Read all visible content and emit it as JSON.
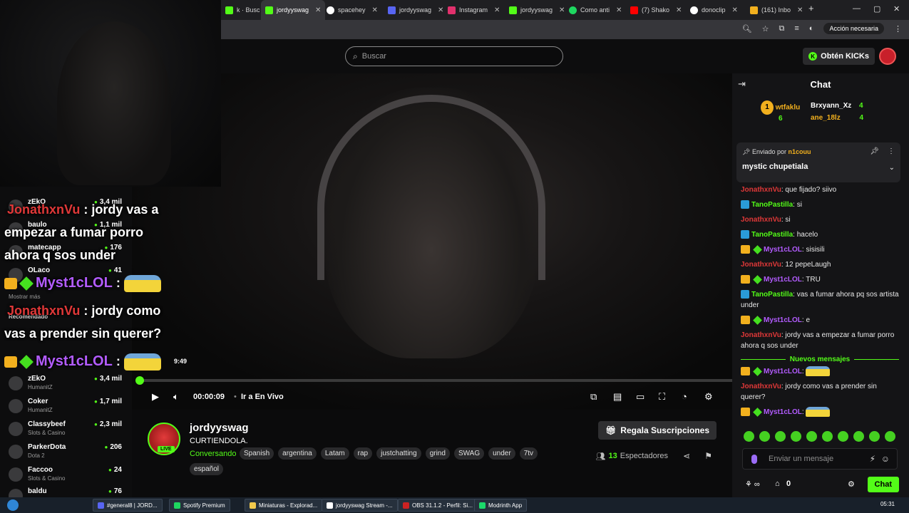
{
  "browser": {
    "tabs": [
      {
        "label": "k · Busc",
        "color": "#53fc18"
      },
      {
        "label": "jordyyswag",
        "color": "#53fc18",
        "active": true
      },
      {
        "label": "spacehey",
        "color": "#ffffff"
      },
      {
        "label": "jordyyswag",
        "color": "#5865f2"
      },
      {
        "label": "Instagram",
        "color": "#e1306c"
      },
      {
        "label": "jordyyswag",
        "color": "#53fc18"
      },
      {
        "label": "Como anti",
        "color": "#1ed760"
      },
      {
        "label": "(7) Shako",
        "color": "#ff0000"
      },
      {
        "label": "donoclip",
        "color": "#ffffff"
      },
      {
        "label": "(161) Inbo",
        "color": "#f2b01e"
      }
    ],
    "new_tab": "+",
    "request_button": "Acción necesaria"
  },
  "site": {
    "search_placeholder": "Buscar",
    "kicks_button": "Obtén KICKs",
    "kicks_icon": "K"
  },
  "overlay": {
    "lines": [
      {
        "user": "JonathxnVu",
        "text": " : jordy vas a"
      },
      {
        "text": "empezar a fumar porro"
      },
      {
        "text": "ahora q sos under"
      },
      {
        "user": "Myst1cLOL",
        "text": " :"
      },
      {
        "user": "JonathxnVu",
        "text": " : jordy como"
      },
      {
        "text": "vas a prender sin querer?"
      },
      {
        "user": "Myst1cLOL",
        "text": " :"
      }
    ],
    "timecode": "9:49"
  },
  "sidebar": {
    "recommended_label": "Recomendado",
    "show_more": "Mostrar más",
    "items_top": [
      {
        "name": "zEkO",
        "category": "",
        "count": "3,4 mil"
      },
      {
        "name": "baulo",
        "category": "",
        "count": "1,1 mil"
      },
      {
        "name": "matecapp",
        "category": "",
        "count": "176"
      },
      {
        "name": "OLaco",
        "category": "",
        "count": "41"
      }
    ],
    "items": [
      {
        "name": "zEkO",
        "category": "HumanitZ",
        "count": "3,4 mil"
      },
      {
        "name": "Coker",
        "category": "HumanitZ",
        "count": "1,7 mil"
      },
      {
        "name": "Classybeef",
        "category": "Slots & Casino",
        "count": "2,3 mil"
      },
      {
        "name": "ParkerDota",
        "category": "Dota 2",
        "count": "206"
      },
      {
        "name": "Faccoo",
        "category": "Slots & Casino",
        "count": "24"
      },
      {
        "name": "baldu",
        "category": "",
        "count": "76"
      }
    ]
  },
  "player": {
    "progress": 0.0,
    "time": "00:00:09",
    "live_link": "Ir a En Vivo"
  },
  "stream": {
    "channel": "jordyyswag",
    "title": "CURTIENDOLA.",
    "category": "Conversando",
    "live_badge": "LIVE",
    "tags": [
      "Spanish",
      "argentina",
      "Latam",
      "rap",
      "justchatting",
      "grind",
      "SWAG",
      "under",
      "7tv"
    ],
    "tag_extra": "español",
    "subs_button": "Regala Suscripciones",
    "viewers_count": "13",
    "viewers_label": "Espectadores"
  },
  "chat": {
    "title": "Chat",
    "leaderboard": [
      {
        "rank": "1",
        "name": "wtfaklu",
        "score": "6"
      },
      {
        "name": "Brxyann_Xz",
        "score": "4"
      },
      {
        "name": "ane_18lz",
        "score": "4"
      }
    ],
    "pinned": {
      "by_prefix": "Enviado por ",
      "by_user": "n1couu",
      "message": "mystic chupetiala"
    },
    "messages": [
      {
        "user": "JonathxnVu",
        "color": "#e03838",
        "badge": "",
        "text": "que fijado? siivo"
      },
      {
        "user": "TanoPastilla",
        "color": "#53fc18",
        "badge": "blue",
        "text": "si"
      },
      {
        "user": "JonathxnVu",
        "color": "#e03838",
        "badge": "",
        "text": "si"
      },
      {
        "user": "TanoPastilla",
        "color": "#53fc18",
        "badge": "blue",
        "text": "hacelo"
      },
      {
        "user": "Myst1cLOL",
        "color": "#b35cff",
        "badge": "crown",
        "text": "sisisili"
      },
      {
        "user": "JonathxnVu",
        "color": "#e03838",
        "badge": "",
        "text": "12 pepeLaugh"
      },
      {
        "user": "Myst1cLOL",
        "color": "#b35cff",
        "badge": "crown",
        "text": "TRU"
      },
      {
        "user": "TanoPastilla",
        "color": "#53fc18",
        "badge": "blue",
        "text": "vas a fumar ahora pq sos artista under"
      },
      {
        "user": "Myst1cLOL",
        "color": "#b35cff",
        "badge": "crown",
        "text": "e"
      },
      {
        "user": "JonathxnVu",
        "color": "#e03838",
        "badge": "",
        "text": "jordy vas a empezar a fumar porro ahora q sos under"
      }
    ],
    "new_messages_label": "Nuevos mensajes",
    "new_messages": [
      {
        "user": "Myst1cLOL",
        "color": "#b35cff",
        "badge": "crown",
        "text": "",
        "emote": true
      },
      {
        "user": "JonathxnVu",
        "color": "#e03838",
        "badge": "",
        "text": "jordy como vas a prender sin querer?"
      },
      {
        "user": "Myst1cLOL",
        "color": "#b35cff",
        "badge": "crown",
        "text": "",
        "emote": true
      }
    ],
    "input_placeholder": "Enviar un mensaje",
    "points": "0",
    "send_button": "Chat"
  },
  "taskbar": {
    "apps": [
      {
        "label": "#general8 | JORD...",
        "color": "#5865f2"
      },
      {
        "label": "Spotify Premium",
        "color": "#1ed760"
      },
      {
        "label": "Miniaturas - Explorad...",
        "color": "#f2c94c"
      },
      {
        "label": "jordyyswag Stream -...",
        "color": "#ffffff"
      },
      {
        "label": "OBS 31.1.2 - Perfil: Si...",
        "color": "#cc2222"
      },
      {
        "label": "Modrinth App",
        "color": "#1bd96a"
      }
    ],
    "clock": "05:31"
  }
}
